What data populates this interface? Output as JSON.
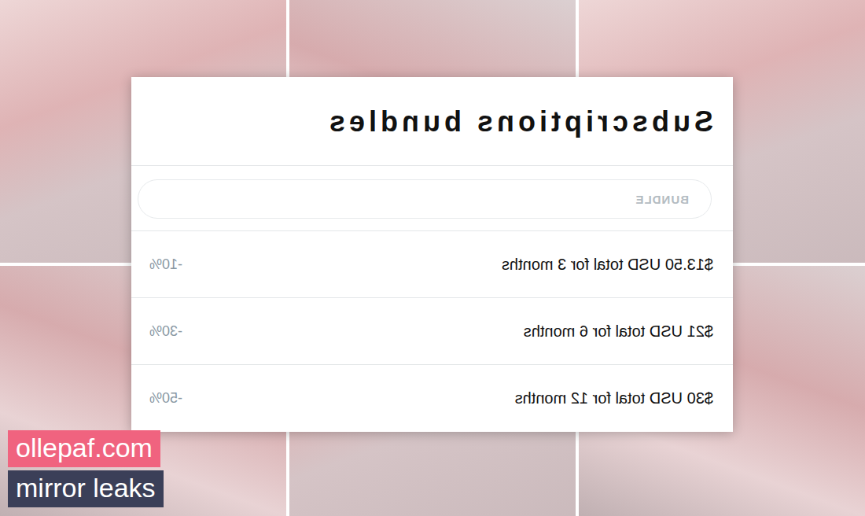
{
  "dialog": {
    "title": "Subscriptions bundles",
    "section": "BUNDLE",
    "bundles": [
      {
        "price": "$13.50 USD total for 3 months",
        "discount": "-10%"
      },
      {
        "price": "$21 USD total for 6 months",
        "discount": "-30%"
      },
      {
        "price": "$30 USD total for 12 months",
        "discount": "-50%"
      }
    ]
  },
  "watermark": {
    "site": "ollepaf.com",
    "tagline": "mirror leaks"
  }
}
